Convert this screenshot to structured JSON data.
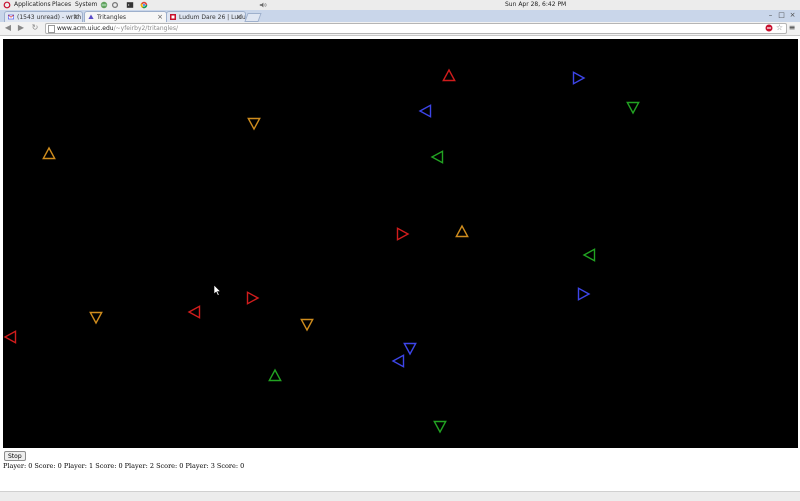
{
  "panel": {
    "menus": [
      "Applications",
      "Places",
      "System"
    ],
    "clock": "Sun Apr 28,  6:42 PM"
  },
  "tabs": [
    {
      "label": "(1543 unread) - writh",
      "active": false,
      "favicon": "mail-icon"
    },
    {
      "label": "Tritangles",
      "active": true,
      "favicon": "triangle-icon"
    },
    {
      "label": "Ludum Dare 26 | Ludu",
      "active": false,
      "favicon": "ludum-dare-icon"
    }
  ],
  "address_bar": {
    "host": "www.acm.uiuc.edu",
    "path": "/~yfeirby2/tritangles/"
  },
  "game": {
    "stop_label": "Stop",
    "scores_text": "Player: 0 Score: 0 Player: 1 Score: 0 Player: 2 Score: 0 Player: 3 Score: 0",
    "colors": {
      "red": "#d01c1c",
      "blue": "#3d45e8",
      "green": "#22a322",
      "orange": "#cf8c1d"
    },
    "triangles": [
      {
        "color": "red",
        "direction": "up"
      },
      {
        "color": "blue",
        "direction": "right"
      },
      {
        "color": "green",
        "direction": "down"
      },
      {
        "color": "blue",
        "direction": "left"
      },
      {
        "color": "orange",
        "direction": "down"
      },
      {
        "color": "orange",
        "direction": "up"
      },
      {
        "color": "green",
        "direction": "left"
      },
      {
        "color": "red",
        "direction": "right"
      },
      {
        "color": "orange",
        "direction": "up"
      },
      {
        "color": "green",
        "direction": "left"
      },
      {
        "color": "blue",
        "direction": "right"
      },
      {
        "color": "red",
        "direction": "right"
      },
      {
        "color": "red",
        "direction": "left"
      },
      {
        "color": "orange",
        "direction": "down"
      },
      {
        "color": "orange",
        "direction": "down"
      },
      {
        "color": "red",
        "direction": "left"
      },
      {
        "color": "blue",
        "direction": "down"
      },
      {
        "color": "blue",
        "direction": "left"
      },
      {
        "color": "green",
        "direction": "up"
      },
      {
        "color": "green",
        "direction": "down"
      }
    ]
  }
}
